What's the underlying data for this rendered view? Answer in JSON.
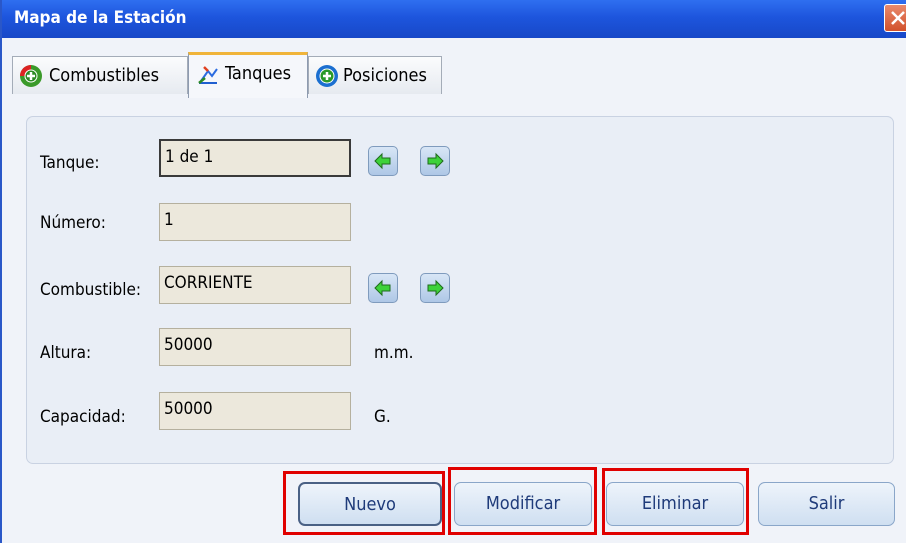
{
  "window": {
    "title": "Mapa de la Estación"
  },
  "tabs": [
    {
      "label": "Combustibles",
      "icon": "add-circle-icon"
    },
    {
      "label": "Tanques",
      "icon": "tank-chart-icon"
    },
    {
      "label": "Posiciones",
      "icon": "add-circle-icon"
    }
  ],
  "form": {
    "tanque": {
      "label": "Tanque:",
      "value": "1 de 1"
    },
    "numero": {
      "label": "Número:",
      "value": "1"
    },
    "combustible": {
      "label": "Combustible:",
      "value": "CORRIENTE"
    },
    "altura": {
      "label": "Altura:",
      "value": "50000",
      "unit": "m.m."
    },
    "capacidad": {
      "label": "Capacidad:",
      "value": "50000",
      "unit": "G."
    }
  },
  "buttons": {
    "nuevo": "Nuevo",
    "modificar": "Modificar",
    "eliminar": "Eliminar",
    "salir": "Salir"
  },
  "colors": {
    "titlebar": "#1d55dd",
    "highlight": "#e00000",
    "accent_tab": "#f0b43a"
  }
}
